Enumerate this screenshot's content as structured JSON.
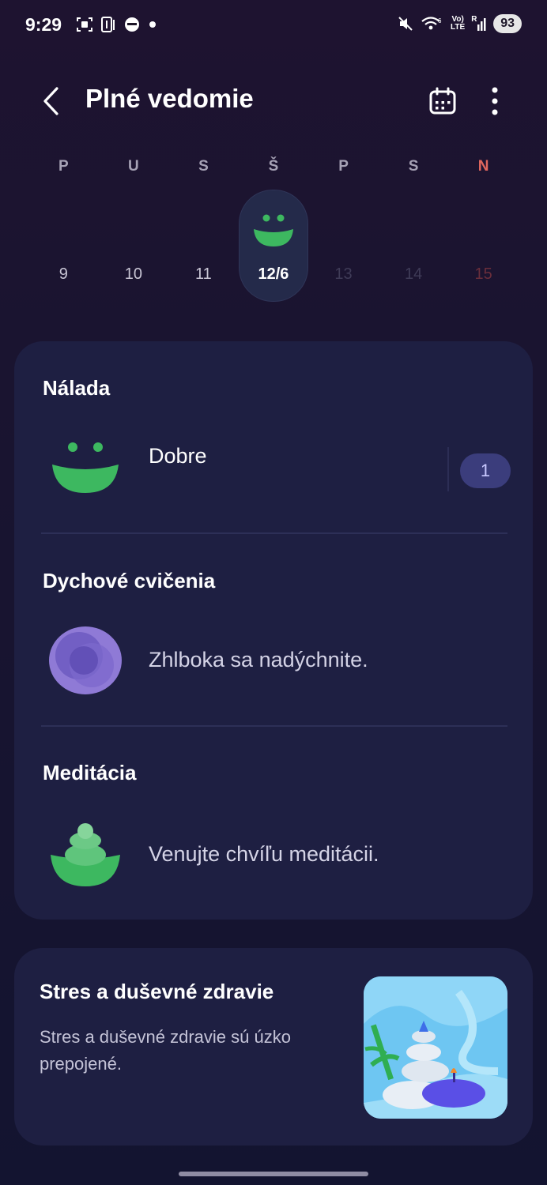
{
  "status_bar": {
    "time": "9:29",
    "battery": "93",
    "lte_label": "LTE",
    "volte_label": "Vo)",
    "roaming_label": "R"
  },
  "header": {
    "title": "Plné vedomie"
  },
  "week": {
    "labels": [
      "P",
      "U",
      "S",
      "Š",
      "P",
      "S",
      "N"
    ],
    "days": [
      "9",
      "10",
      "11",
      "12/6",
      "13",
      "14",
      "15"
    ],
    "selected_index": 3
  },
  "mood": {
    "title": "Nálada",
    "value": "Dobre",
    "count": "1"
  },
  "breathing": {
    "title": "Dychové cvičenia",
    "text": "Zhlboka sa nadýchnite."
  },
  "meditation": {
    "title": "Meditácia",
    "text": "Venujte chvíľu meditácii."
  },
  "promo": {
    "title": "Stres a duševné zdravie",
    "body": "Stres a duševné zdravie sú úzko prepojené."
  },
  "colors": {
    "accent_green": "#3db860",
    "card_bg": "#1e1f42",
    "badge_bg": "#3b3d7c",
    "sunday_red": "#e0675e",
    "breathing_purple": "#8f7ad6"
  }
}
